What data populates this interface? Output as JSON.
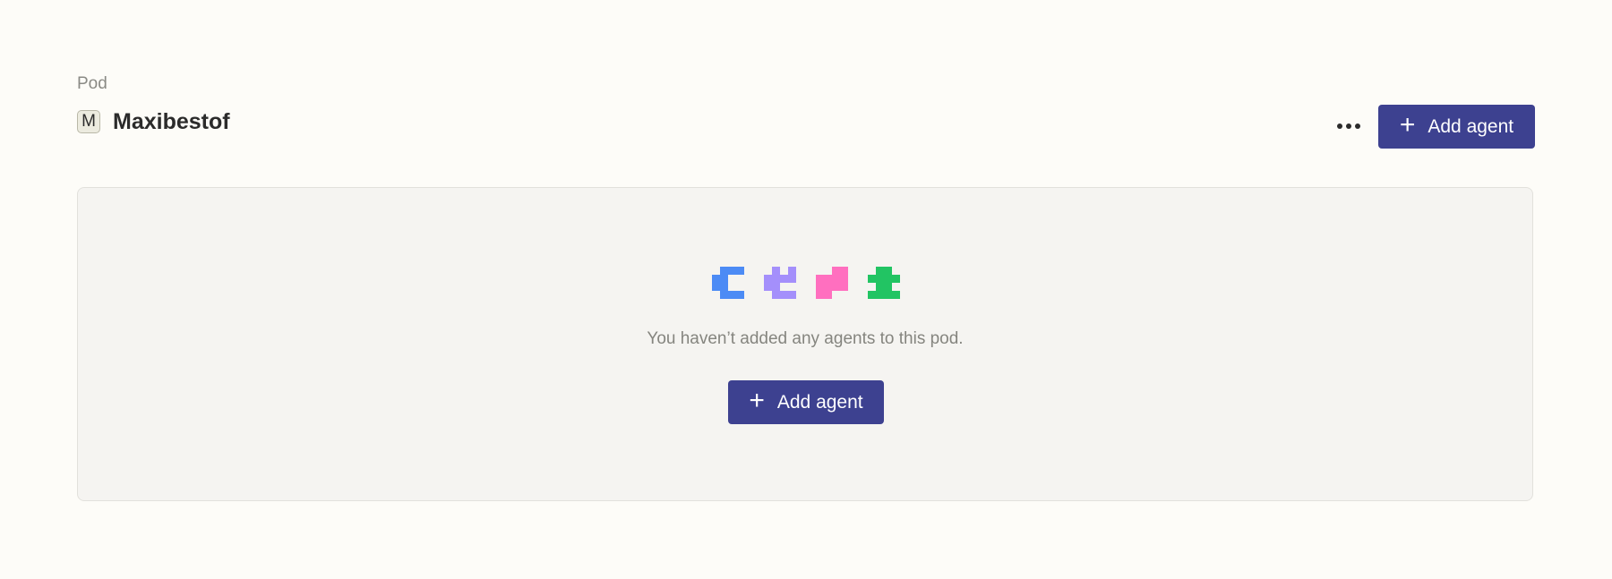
{
  "header": {
    "section_label": "Pod",
    "avatar_letter": "M",
    "title": "Maxibestof",
    "add_agent_label": "Add agent"
  },
  "empty_state": {
    "message": "You haven’t added any agents to this pod.",
    "add_agent_label": "Add agent",
    "icons": [
      {
        "name": "blue-agent-icon",
        "color": "#4c8bf5"
      },
      {
        "name": "purple-agent-icon",
        "color": "#a48ffb"
      },
      {
        "name": "pink-agent-icon",
        "color": "#ff6fbf"
      },
      {
        "name": "green-agent-icon",
        "color": "#22c463"
      }
    ]
  },
  "colors": {
    "primary": "#3d4190",
    "background": "#fdfcf8",
    "panel": "#f5f4f1"
  }
}
